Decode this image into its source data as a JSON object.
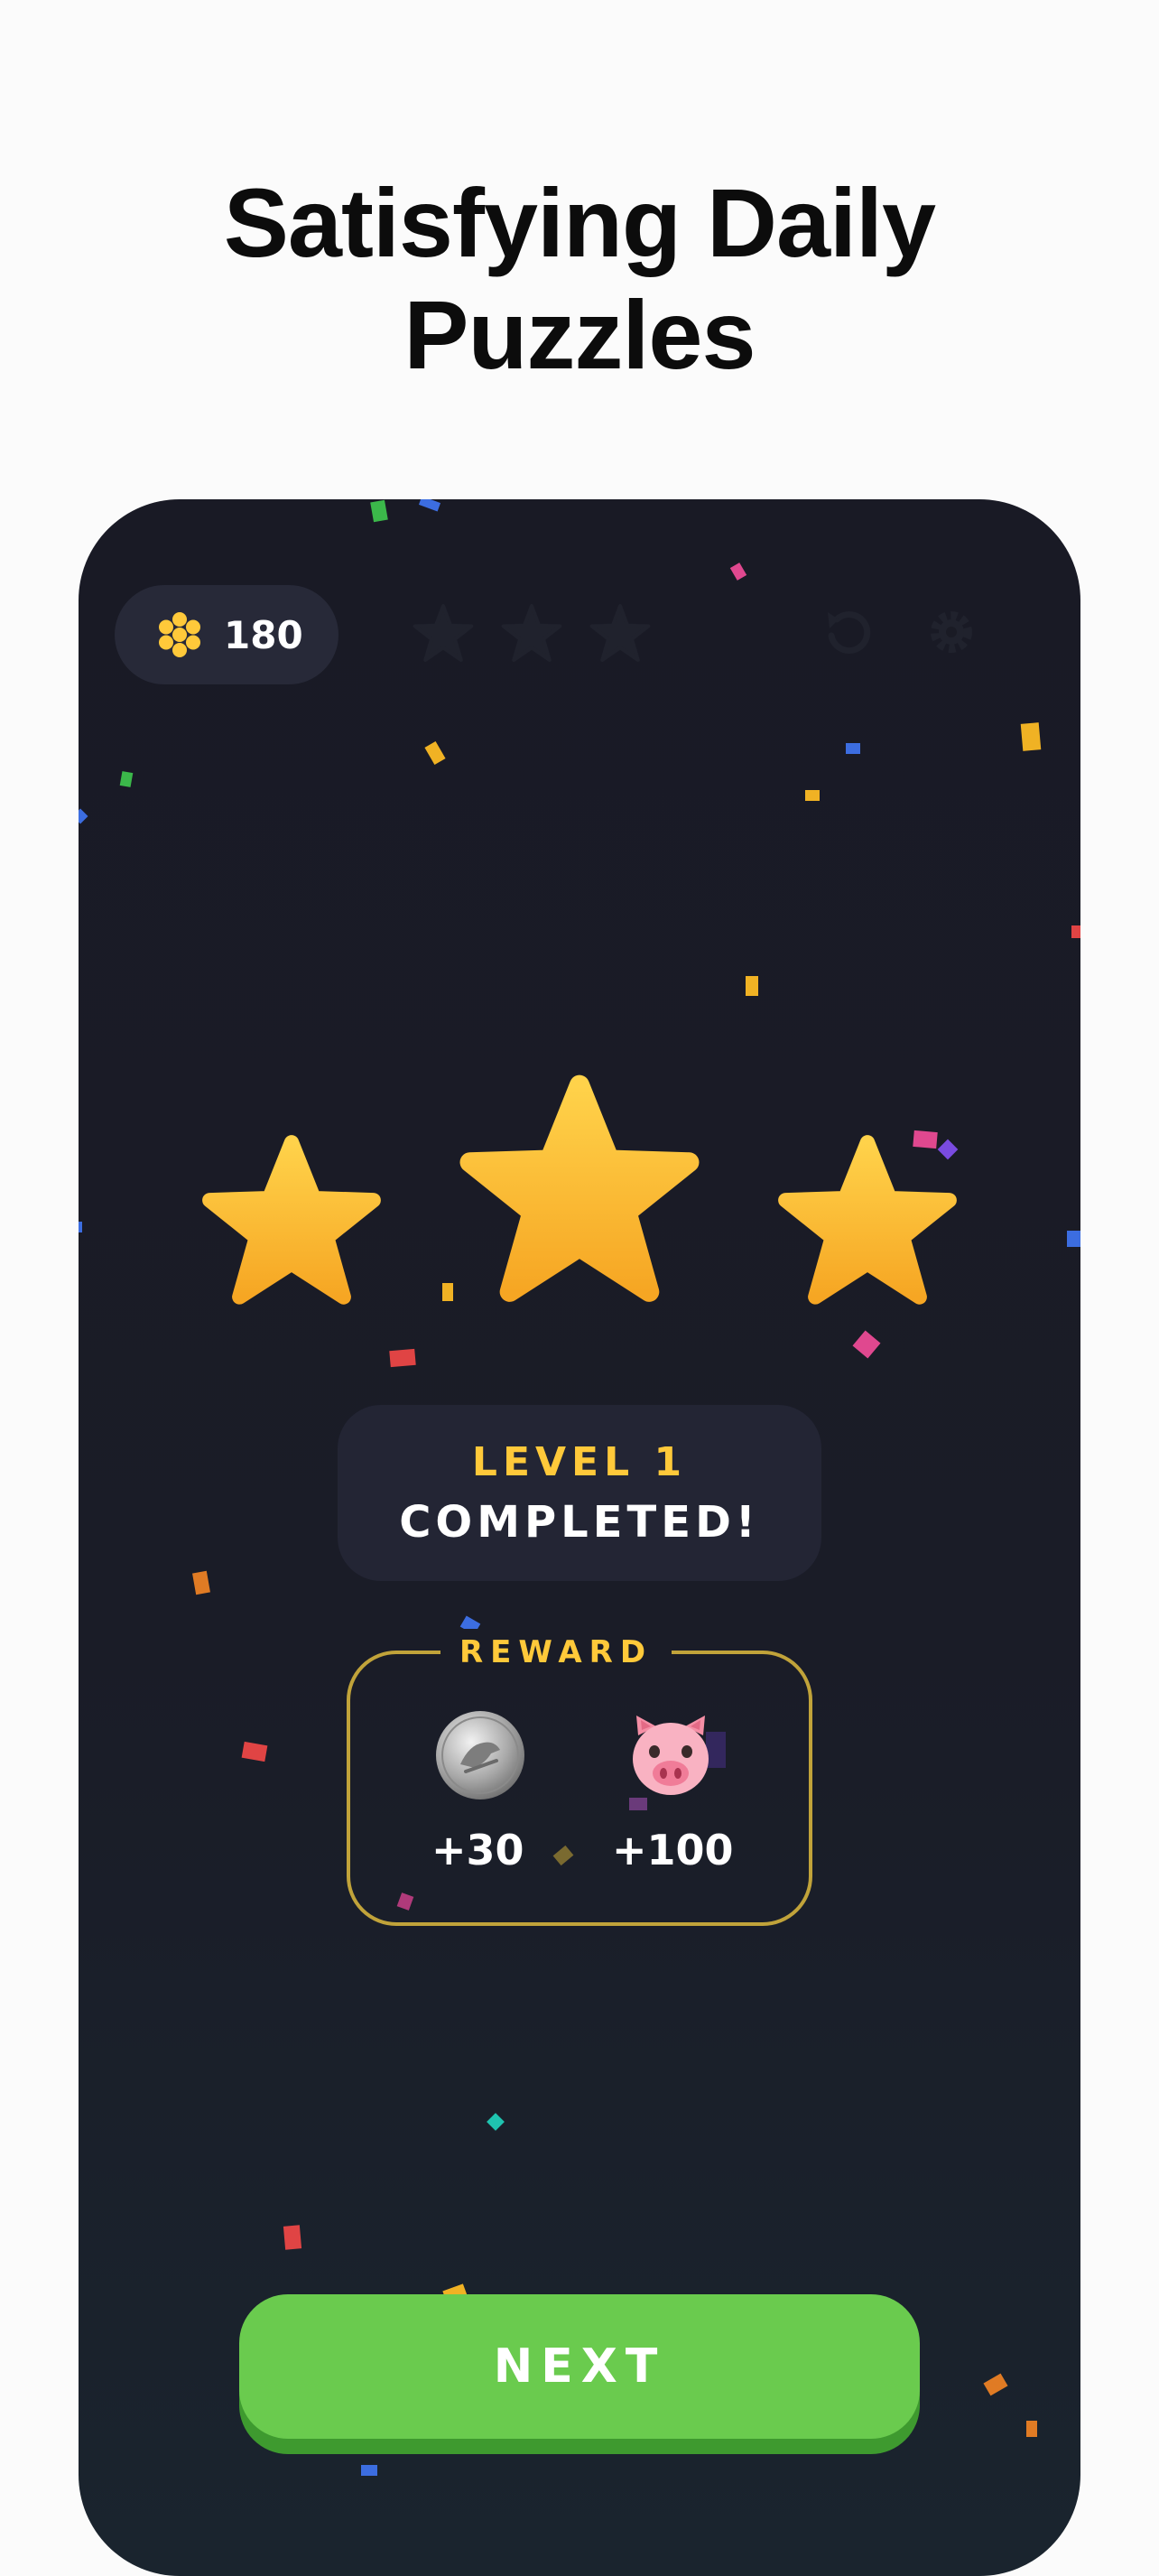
{
  "headline": {
    "line1": "Satisfying Daily",
    "line2": "Puzzles"
  },
  "topbar": {
    "coin_icon": "honeycomb-coin-icon",
    "coins": "180",
    "stars_earned": 0,
    "icons": [
      "undo-icon",
      "settings-gear-icon"
    ]
  },
  "result": {
    "stars": 3,
    "level_label": "LEVEL 1",
    "status_label": "COMPLETED!"
  },
  "reward": {
    "title": "REWARD",
    "items": [
      {
        "icon": "silver-coin-icon",
        "amount": "+30"
      },
      {
        "icon": "pig-face-icon",
        "amount": "+100"
      }
    ]
  },
  "next_button": {
    "label": "NEXT"
  },
  "colors": {
    "background": "#191a25",
    "star": "#ffc93a",
    "accent_green": "#6acb4e",
    "reward_border": "#c1a33a"
  }
}
